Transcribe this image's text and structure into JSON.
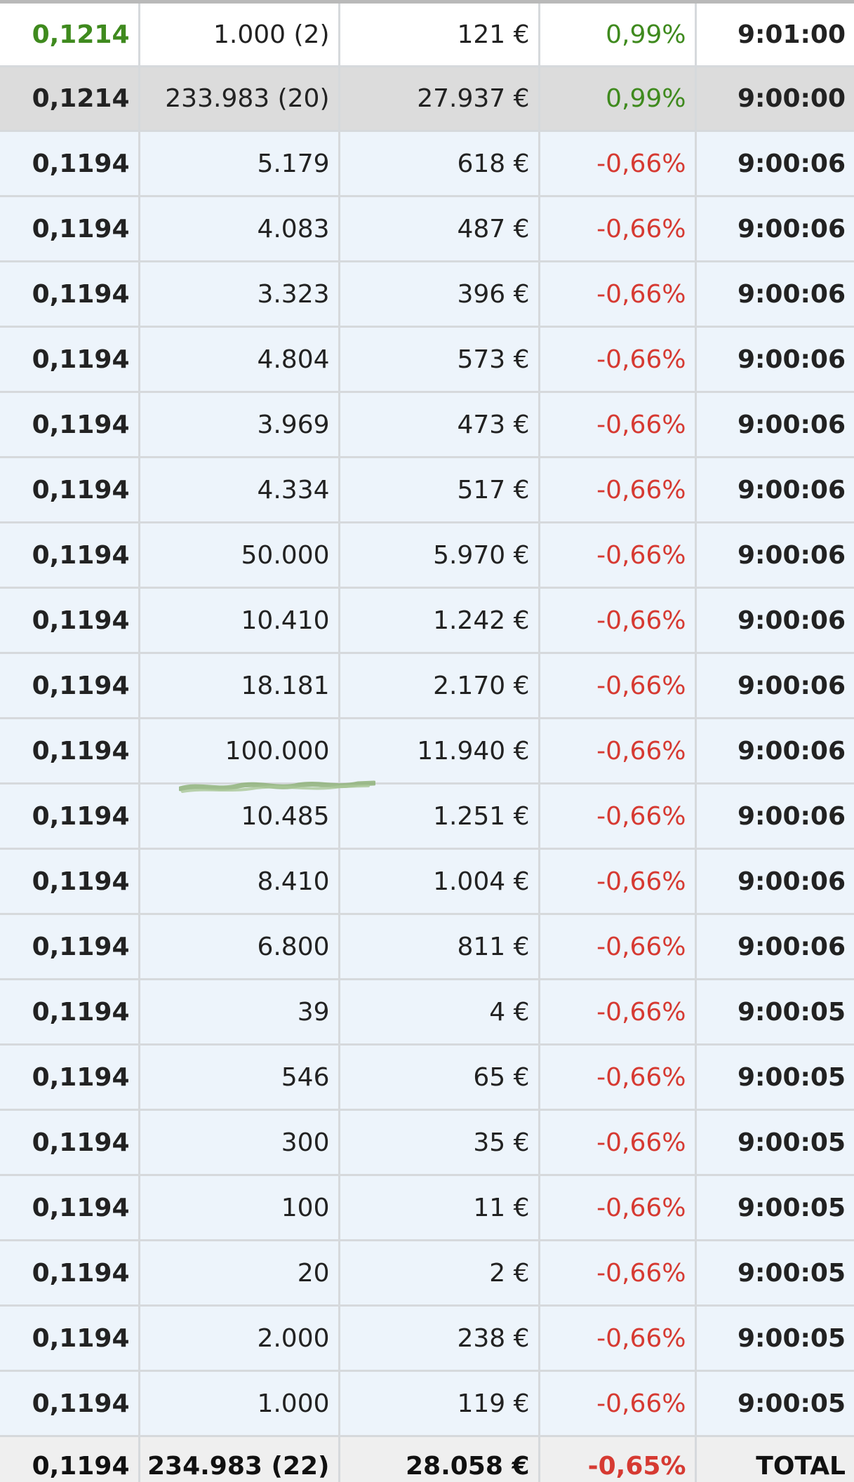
{
  "colors": {
    "up": "#3f8a1e",
    "down": "#d63a32",
    "row_bg": "#edf4fb",
    "summary_bg": "#dcdcdc"
  },
  "first_row": {
    "price": "0,1214",
    "volume": "1.000 (2)",
    "amount": "121 €",
    "change": "0,99%",
    "time": "9:01:00"
  },
  "summary_row": {
    "price": "0,1214",
    "volume": "233.983 (20)",
    "amount": "27.937 €",
    "change": "0,99%",
    "time": "9:00:00"
  },
  "trades": [
    {
      "price": "0,1194",
      "volume": "5.179",
      "amount": "618 €",
      "change": "-0,66%",
      "time": "9:00:06"
    },
    {
      "price": "0,1194",
      "volume": "4.083",
      "amount": "487 €",
      "change": "-0,66%",
      "time": "9:00:06"
    },
    {
      "price": "0,1194",
      "volume": "3.323",
      "amount": "396 €",
      "change": "-0,66%",
      "time": "9:00:06"
    },
    {
      "price": "0,1194",
      "volume": "4.804",
      "amount": "573 €",
      "change": "-0,66%",
      "time": "9:00:06"
    },
    {
      "price": "0,1194",
      "volume": "3.969",
      "amount": "473 €",
      "change": "-0,66%",
      "time": "9:00:06"
    },
    {
      "price": "0,1194",
      "volume": "4.334",
      "amount": "517 €",
      "change": "-0,66%",
      "time": "9:00:06"
    },
    {
      "price": "0,1194",
      "volume": "50.000",
      "amount": "5.970 €",
      "change": "-0,66%",
      "time": "9:00:06"
    },
    {
      "price": "0,1194",
      "volume": "10.410",
      "amount": "1.242 €",
      "change": "-0,66%",
      "time": "9:00:06"
    },
    {
      "price": "0,1194",
      "volume": "18.181",
      "amount": "2.170 €",
      "change": "-0,66%",
      "time": "9:00:06"
    },
    {
      "price": "0,1194",
      "volume": "100.000",
      "amount": "11.940 €",
      "change": "-0,66%",
      "time": "9:00:06"
    },
    {
      "price": "0,1194",
      "volume": "10.485",
      "amount": "1.251 €",
      "change": "-0,66%",
      "time": "9:00:06"
    },
    {
      "price": "0,1194",
      "volume": "8.410",
      "amount": "1.004 €",
      "change": "-0,66%",
      "time": "9:00:06"
    },
    {
      "price": "0,1194",
      "volume": "6.800",
      "amount": "811 €",
      "change": "-0,66%",
      "time": "9:00:06"
    },
    {
      "price": "0,1194",
      "volume": "39",
      "amount": "4 €",
      "change": "-0,66%",
      "time": "9:00:05"
    },
    {
      "price": "0,1194",
      "volume": "546",
      "amount": "65 €",
      "change": "-0,66%",
      "time": "9:00:05"
    },
    {
      "price": "0,1194",
      "volume": "300",
      "amount": "35 €",
      "change": "-0,66%",
      "time": "9:00:05"
    },
    {
      "price": "0,1194",
      "volume": "100",
      "amount": "11 €",
      "change": "-0,66%",
      "time": "9:00:05"
    },
    {
      "price": "0,1194",
      "volume": "20",
      "amount": "2 €",
      "change": "-0,66%",
      "time": "9:00:05"
    },
    {
      "price": "0,1194",
      "volume": "2.000",
      "amount": "238 €",
      "change": "-0,66%",
      "time": "9:00:05"
    },
    {
      "price": "0,1194",
      "volume": "1.000",
      "amount": "119 €",
      "change": "-0,66%",
      "time": "9:00:05"
    }
  ],
  "total_row": {
    "price": "0,1194",
    "volume": "234.983 (22)",
    "amount": "28.058 €",
    "change": "-0,65%",
    "label": "TOTAL"
  }
}
